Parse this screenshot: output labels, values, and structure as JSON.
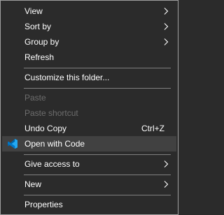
{
  "menu": {
    "view": "View",
    "sort_by": "Sort by",
    "group_by": "Group by",
    "refresh": "Refresh",
    "customize": "Customize this folder...",
    "paste": "Paste",
    "paste_shortcut": "Paste shortcut",
    "undo_copy": "Undo Copy",
    "undo_copy_shortcut": "Ctrl+Z",
    "open_with_code": "Open with Code",
    "give_access": "Give access to",
    "new": "New",
    "properties": "Properties"
  },
  "icons": {
    "submenu": "chevron-right-icon",
    "vscode": "vscode-icon"
  },
  "colors": {
    "background": "#2b2b2b",
    "text": "#ffffff",
    "disabled_text": "#6d6d6d",
    "separator": "#808080",
    "hover": "#414141",
    "vscode_blue": "#23a9f2"
  }
}
